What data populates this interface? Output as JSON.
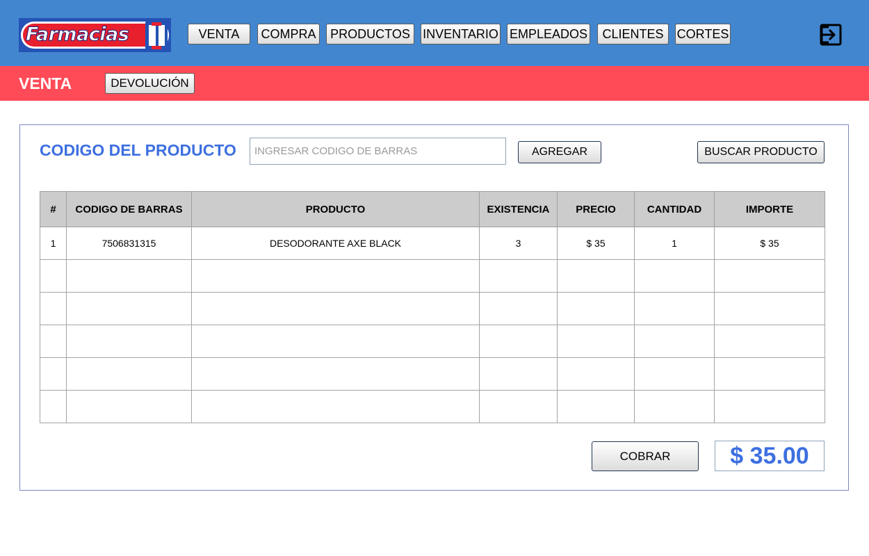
{
  "app": {
    "logo_text": "Farmacias"
  },
  "nav": {
    "items": [
      {
        "label": "VENTA"
      },
      {
        "label": "COMPRA"
      },
      {
        "label": "PRODUCTOS"
      },
      {
        "label": "INVENTARIO"
      },
      {
        "label": "EMPLEADOS"
      },
      {
        "label": "CLIENTES"
      },
      {
        "label": "CORTES"
      }
    ],
    "logout_icon": "logout-icon"
  },
  "section": {
    "title": "VENTA",
    "devolucion_label": "DEVOLUCIÓN"
  },
  "form": {
    "code_label": "CODIGO DEL PRODUCTO",
    "code_placeholder": "INGRESAR CODIGO DE BARRAS",
    "code_value": "",
    "add_label": "AGREGAR",
    "search_label": "BUSCAR PRODUCTO"
  },
  "table": {
    "headers": [
      "#",
      "CODIGO DE BARRAS",
      "PRODUCTO",
      "EXISTENCIA",
      "PRECIO",
      "CANTIDAD",
      "IMPORTE"
    ],
    "rows": [
      [
        "1",
        "7506831315",
        "DESODORANTE AXE BLACK",
        "3",
        "$ 35",
        "1",
        "$ 35"
      ],
      [
        "",
        "",
        "",
        "",
        "",
        "",
        ""
      ],
      [
        "",
        "",
        "",
        "",
        "",
        "",
        ""
      ],
      [
        "",
        "",
        "",
        "",
        "",
        "",
        ""
      ],
      [
        "",
        "",
        "",
        "",
        "",
        "",
        ""
      ],
      [
        "",
        "",
        "",
        "",
        "",
        "",
        ""
      ]
    ]
  },
  "footer": {
    "charge_label": "COBRAR",
    "total": "$ 35.00"
  },
  "colors": {
    "topbar": "#4286cf",
    "subbar": "#ff4b58",
    "accent_text": "#3d6fe0"
  }
}
